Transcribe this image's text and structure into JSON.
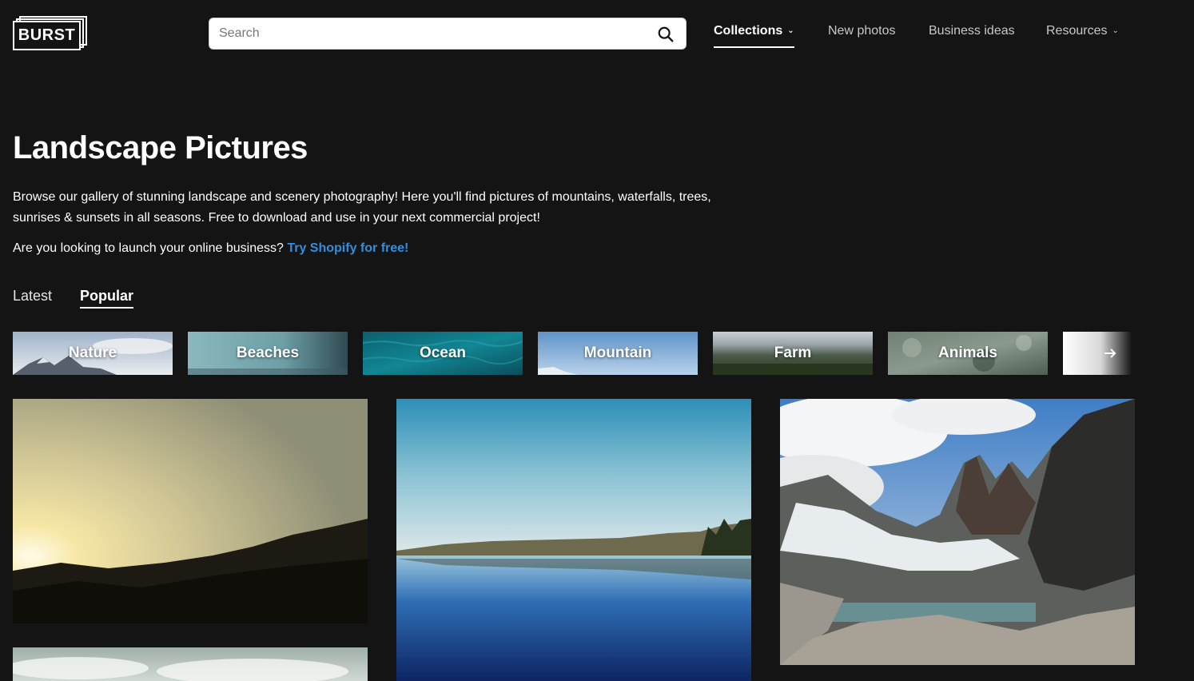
{
  "brand": {
    "logo_text": "BURST"
  },
  "search": {
    "placeholder": "Search"
  },
  "nav": {
    "collections": "Collections",
    "new_photos": "New photos",
    "business_ideas": "Business ideas",
    "resources": "Resources"
  },
  "page": {
    "title": "Landscape Pictures",
    "description": "Browse our gallery of stunning landscape and scenery photography! Here you'll find pictures of mountains, waterfalls, trees, sunrises & sunsets in all seasons. Free to download and use in your next commercial project!",
    "promo_text": "Are you looking to launch your online business?",
    "promo_link": "Try Shopify for free!"
  },
  "tabs": {
    "latest": "Latest",
    "popular": "Popular",
    "active": "Popular"
  },
  "categories": [
    "Nature",
    "Beaches",
    "Ocean",
    "Mountain",
    "Farm",
    "Animals"
  ],
  "colors": {
    "background": "#141414",
    "link": "#2f8fe0",
    "text": "#ffffff",
    "nav_inactive": "#c8c8c8"
  },
  "icons": {
    "search": "search-icon",
    "chevron": "chevron-down-icon",
    "next": "arrow-right-icon"
  }
}
